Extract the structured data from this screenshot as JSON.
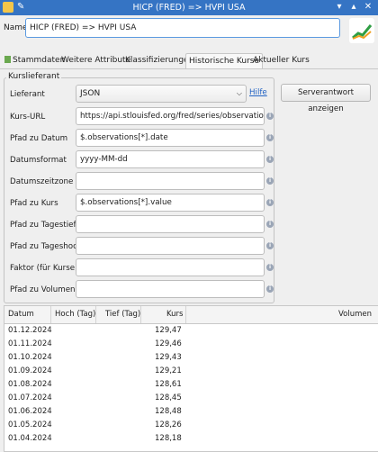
{
  "window": {
    "title": "HICP (FRED) => HVPI USA",
    "icons": [
      "app-icon",
      "pin-icon",
      "minimize-icon",
      "maximize-icon",
      "close-icon"
    ],
    "accent": "#3574c4"
  },
  "name_row": {
    "label": "Name",
    "value": "HICP (FRED) => HVPI USA"
  },
  "tabs": [
    {
      "label": "Stammdaten",
      "active": false
    },
    {
      "label": "Weitere Attribute",
      "active": false
    },
    {
      "label": "Klassifizierungen",
      "active": false
    },
    {
      "label": "Historische Kurse",
      "active": true
    },
    {
      "label": "Aktueller Kurs",
      "active": false
    }
  ],
  "group": {
    "title": "Kurslieferant",
    "provider_label": "Lieferant",
    "provider_value": "JSON",
    "help_link": "Hilfe",
    "fields": [
      {
        "label": "Kurs-URL",
        "value": "https://api.stlouisfed.org/fred/series/observations?se"
      },
      {
        "label": "Pfad zu Datum",
        "value": "$.observations[*].date"
      },
      {
        "label": "Datumsformat",
        "value": "yyyy-MM-dd"
      },
      {
        "label": "Datumszeitzone",
        "value": ""
      },
      {
        "label": "Pfad zu Kurs",
        "value": "$.observations[*].value"
      },
      {
        "label": "Pfad zu Tagestief",
        "value": ""
      },
      {
        "label": "Pfad zu Tageshoch",
        "value": ""
      },
      {
        "label": "Faktor (für Kurse)",
        "value": ""
      },
      {
        "label": "Pfad zu Volumen",
        "value": ""
      }
    ]
  },
  "server_button": "Serverantwort anzeigen",
  "table": {
    "columns": [
      "Datum",
      "Hoch (Tag)",
      "Tief (Tag)",
      "Kurs",
      "Volumen"
    ],
    "rows": [
      {
        "date": "01.12.2024",
        "kurs": "129,47"
      },
      {
        "date": "01.11.2024",
        "kurs": "129,46"
      },
      {
        "date": "01.10.2024",
        "kurs": "129,43"
      },
      {
        "date": "01.09.2024",
        "kurs": "129,21"
      },
      {
        "date": "01.08.2024",
        "kurs": "128,61"
      },
      {
        "date": "01.07.2024",
        "kurs": "128,45"
      },
      {
        "date": "01.06.2024",
        "kurs": "128,48"
      },
      {
        "date": "01.05.2024",
        "kurs": "128,26"
      },
      {
        "date": "01.04.2024",
        "kurs": "128,18"
      }
    ]
  }
}
